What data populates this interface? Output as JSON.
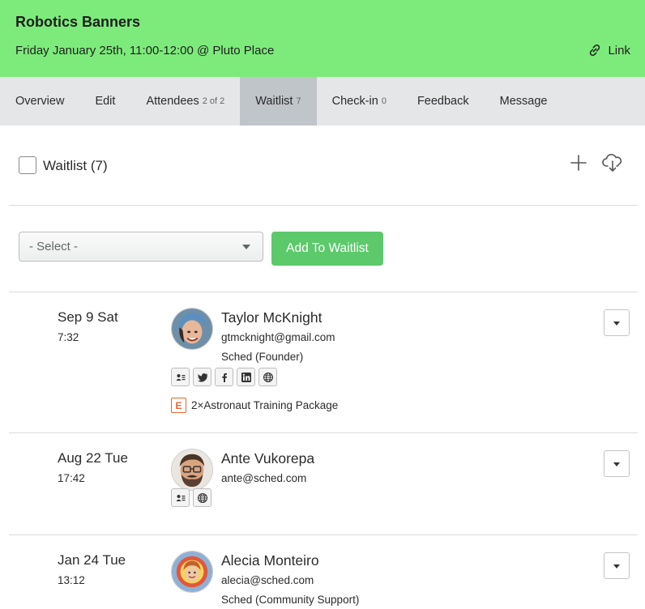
{
  "header": {
    "title": "Robotics Banners",
    "subtitle": "Friday January 25th, 11:00-12:00 @ Pluto Place",
    "link_label": "Link"
  },
  "tabs": [
    {
      "label": "Overview",
      "count": ""
    },
    {
      "label": "Edit",
      "count": ""
    },
    {
      "label": "Attendees",
      "count": "2 of 2"
    },
    {
      "label": "Waitlist",
      "count": "7",
      "active": true
    },
    {
      "label": "Check-in",
      "count": "0"
    },
    {
      "label": "Feedback",
      "count": ""
    },
    {
      "label": "Message",
      "count": ""
    }
  ],
  "waitlist": {
    "title": "Waitlist (7)",
    "add_icon": "plus-icon",
    "export_icon": "cloud-download-icon"
  },
  "add_form": {
    "select_value": "- Select -",
    "add_button": "Add To Waitlist"
  },
  "entries": [
    {
      "date": "Sep 9 Sat",
      "time": "7:32",
      "name": "Taylor McKnight",
      "email": "gtmcknight@gmail.com",
      "company": "Sched (Founder)",
      "socials": [
        "contact-card-icon",
        "twitter-icon",
        "facebook-icon",
        "linkedin-icon",
        "globe-icon"
      ],
      "ticket_badge": "E",
      "ticket": "2×Astronaut Training Package"
    },
    {
      "date": "Aug 22 Tue",
      "time": "17:42",
      "name": "Ante Vukorepa",
      "email": "ante@sched.com",
      "company": "",
      "socials": [
        "contact-card-icon",
        "globe-icon"
      ]
    },
    {
      "date": "Jan 24 Tue",
      "time": "13:12",
      "name": "Alecia Monteiro",
      "email": "alecia@sched.com",
      "company": "Sched (Community Support)",
      "socials": []
    }
  ],
  "colors": {
    "header_bg": "#7deb7b",
    "tab_bar_bg": "#e4e6e8",
    "tab_active_bg": "#c0c5ca",
    "add_button_bg": "#5cc96b",
    "ticket_badge": "#e8662f"
  }
}
